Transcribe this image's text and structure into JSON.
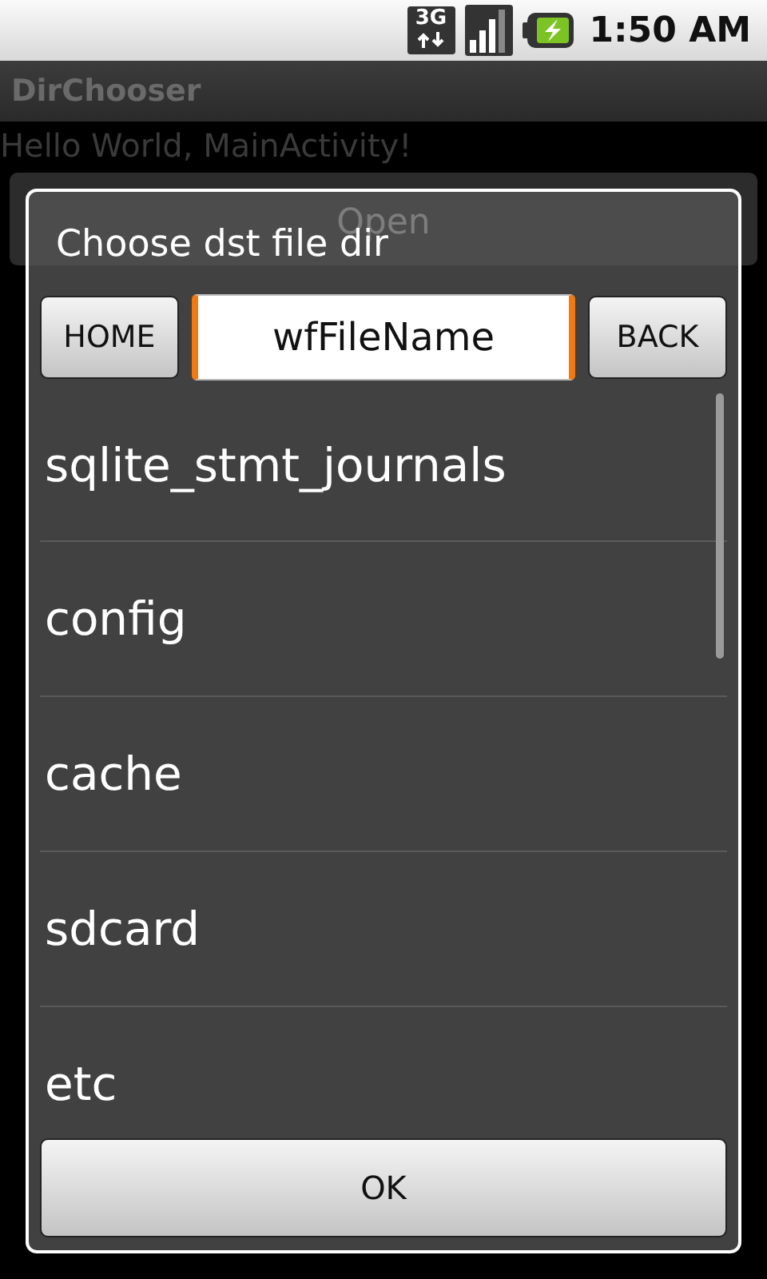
{
  "status_bar": {
    "network_label": "3G",
    "time": "1:50 AM"
  },
  "app": {
    "title": "DirChooser",
    "greeting": "Hello World, MainActivity!",
    "open_button": "Open"
  },
  "dialog": {
    "title": "Choose dst file dir",
    "home_button": "HOME",
    "back_button": "BACK",
    "file_name_field": {
      "value": "wfFileName",
      "focused": true
    },
    "items": [
      {
        "label": "sqlite_stmt_journals"
      },
      {
        "label": "config"
      },
      {
        "label": "cache"
      },
      {
        "label": "sdcard"
      },
      {
        "label": "etc"
      }
    ],
    "ok_button": "OK"
  }
}
